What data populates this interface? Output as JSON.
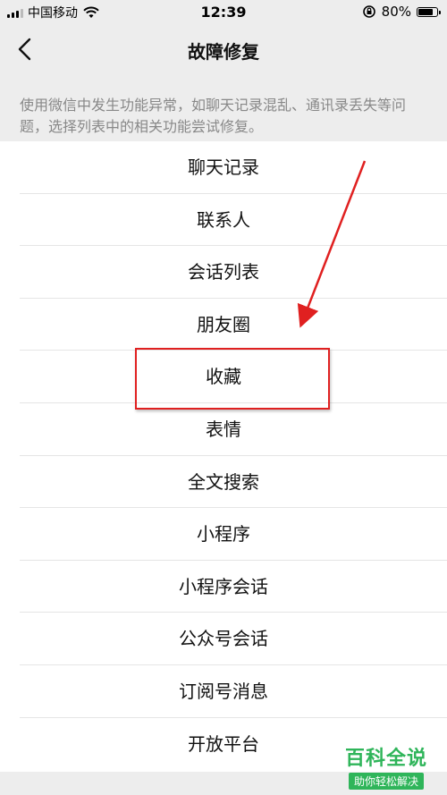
{
  "status_bar": {
    "carrier": "中国移动",
    "time": "12:39",
    "battery": "80%",
    "battery_level": 0.8
  },
  "nav": {
    "title": "故障修复"
  },
  "description": "使用微信中发生功能异常，如聊天记录混乱、通讯录丢失等问题，选择列表中的相关功能尝试修复。",
  "list": {
    "items": [
      {
        "label": "聊天记录"
      },
      {
        "label": "联系人"
      },
      {
        "label": "会话列表"
      },
      {
        "label": "朋友圈"
      },
      {
        "label": "收藏"
      },
      {
        "label": "表情"
      },
      {
        "label": "全文搜索"
      },
      {
        "label": "小程序"
      },
      {
        "label": "小程序会话"
      },
      {
        "label": "公众号会话"
      },
      {
        "label": "订阅号消息"
      },
      {
        "label": "开放平台"
      }
    ],
    "highlighted": "收藏"
  },
  "watermark": {
    "main": "百科全说",
    "sub": "助你轻松解决"
  },
  "colors": {
    "highlight": "#e02020",
    "watermark": "#2fb55a"
  }
}
